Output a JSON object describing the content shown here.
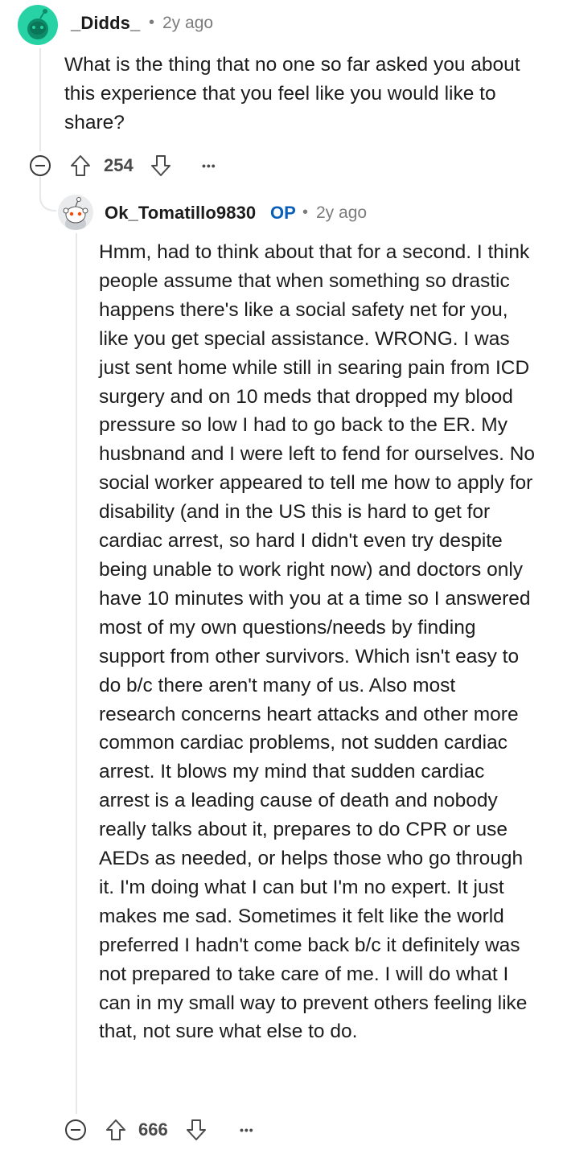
{
  "parent_comment": {
    "username": "_Didds_",
    "separator": "•",
    "time": "2y ago",
    "body": "What is the thing that no one so far asked you about this experience that you feel like you would like to share?",
    "votes": "254",
    "more": "•••"
  },
  "reply_comment": {
    "username": "Ok_Tomatillo9830",
    "op_badge": "OP",
    "separator": "•",
    "time": "2y ago",
    "body": "Hmm, had to think about that for a second. I think people assume that when something so drastic happens there's like a social safety net for you, like you get special assistance. WRONG. I was just sent home while still in searing pain from ICD surgery and on 10 meds that dropped my blood pressure so low I had to go back to the ER. My husbnand and I were left to fend for ourselves. No social worker appeared to tell me how to apply for disability (and in the US this is hard to get for cardiac arrest, so hard I didn't even try despite being unable to work right now) and doctors only have 10 minutes with you at a time so I answered most of my own questions/needs by finding support from other survivors. Which isn't easy to do b/c there aren't many of us. Also most research concerns heart attacks and other more common cardiac problems, not sudden cardiac arrest. It blows my mind that sudden cardiac arrest is a leading cause of death and nobody really talks about it, prepares to do CPR or use AEDs as needed, or helps those who go through it. I'm doing what I can but I'm no expert. It just makes me sad. Sometimes it felt like the world preferred I hadn't come back b/c it definitely was not prepared to take care of me. I will do what I can in my small way to prevent others feeling like that, not sure what else to do.",
    "votes": "666",
    "more": "•••"
  },
  "colors": {
    "parent_avatar": "#27d3a4",
    "op_badge": "#0a5fb8",
    "meta_gray": "#7c7c7c",
    "thread_line": "#e5e7e9"
  },
  "icons": {
    "upvote": "arrow-up-outline-icon",
    "downvote": "arrow-down-outline-icon",
    "collapse": "minus-circle-icon",
    "more": "ellipsis-icon"
  }
}
